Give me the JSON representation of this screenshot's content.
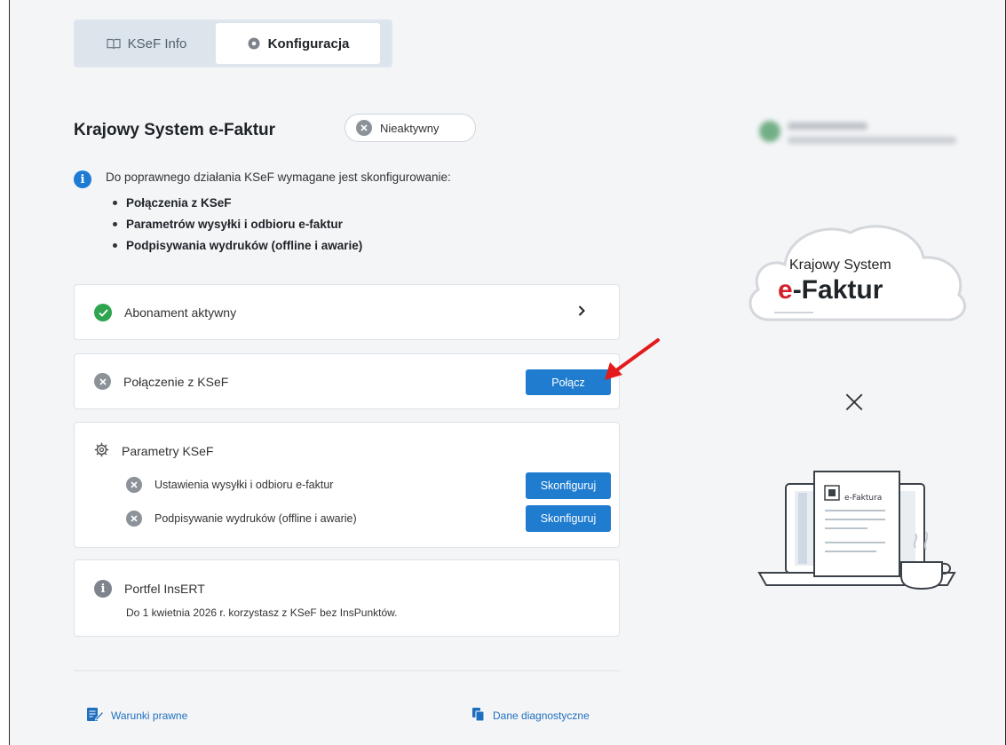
{
  "tabs": [
    {
      "label": "KSeF Info",
      "icon": "book-icon",
      "active": false
    },
    {
      "label": "Konfiguracja",
      "icon": "gear-icon",
      "active": true
    }
  ],
  "header": {
    "title": "Krajowy System e-Faktur",
    "status": "Nieaktywny"
  },
  "info": {
    "text": "Do poprawnego działania KSeF wymagane jest skonfigurowanie:",
    "items": [
      "Połączenia z KSeF",
      "Parametrów wysyłki i odbioru e-faktur",
      "Podpisywania wydruków (offline i awarie)"
    ]
  },
  "cards": {
    "subscription": {
      "label": "Abonament aktywny"
    },
    "connection": {
      "label": "Połączenie z KSeF",
      "button": "Połącz"
    },
    "parameters": {
      "title": "Parametry KSeF",
      "items": [
        {
          "label": "Ustawienia wysyłki i odbioru e-faktur",
          "button": "Skonfiguruj"
        },
        {
          "label": "Podpisywanie wydruków (offline i awarie)",
          "button": "Skonfiguruj"
        }
      ]
    },
    "wallet": {
      "title": "Portfel InsERT",
      "text": "Do 1 kwietnia 2026 r. korzystasz z KSeF bez InsPunktów."
    }
  },
  "footer": {
    "legal": "Warunki prawne",
    "diagnostics": "Dane diagnostyczne"
  },
  "illustration": {
    "cloud_line1": "Krajowy System",
    "cloud_line2_prefix": "e",
    "cloud_line2_rest": "-Faktur",
    "times": "×",
    "document_label": "e-Faktura"
  },
  "colors": {
    "accent": "#1f7ccf",
    "success": "#2ea44f",
    "brand_red": "#d3202a",
    "arrow_red": "#e31b1b"
  }
}
